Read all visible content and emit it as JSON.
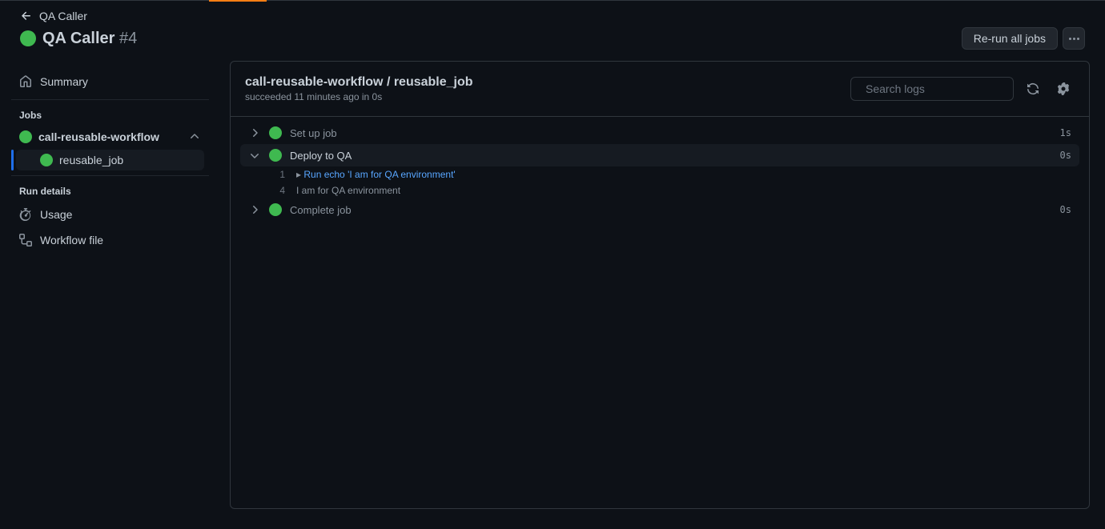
{
  "breadcrumb": {
    "workflow": "QA Caller"
  },
  "header": {
    "title": "QA Caller",
    "run_number": "#4",
    "rerun_button": "Re-run all jobs"
  },
  "sidebar": {
    "summary": "Summary",
    "jobs_heading": "Jobs",
    "workflow_name": "call-reusable-workflow",
    "sub_job": "reusable_job",
    "run_details_heading": "Run details",
    "usage": "Usage",
    "workflow_file": "Workflow file"
  },
  "main": {
    "title": "call-reusable-workflow / reusable_job",
    "subtitle": "succeeded 11 minutes ago in 0s",
    "search_placeholder": "Search logs",
    "steps": [
      {
        "label": "Set up job",
        "duration": "1s",
        "expanded": false
      },
      {
        "label": "Deploy to QA",
        "duration": "0s",
        "expanded": true
      },
      {
        "label": "Complete job",
        "duration": "0s",
        "expanded": false
      }
    ],
    "log_lines": [
      {
        "num": "1",
        "cmd": true,
        "text": "Run echo 'I am for QA environment'"
      },
      {
        "num": "4",
        "cmd": false,
        "text": "I am for QA environment"
      }
    ]
  }
}
